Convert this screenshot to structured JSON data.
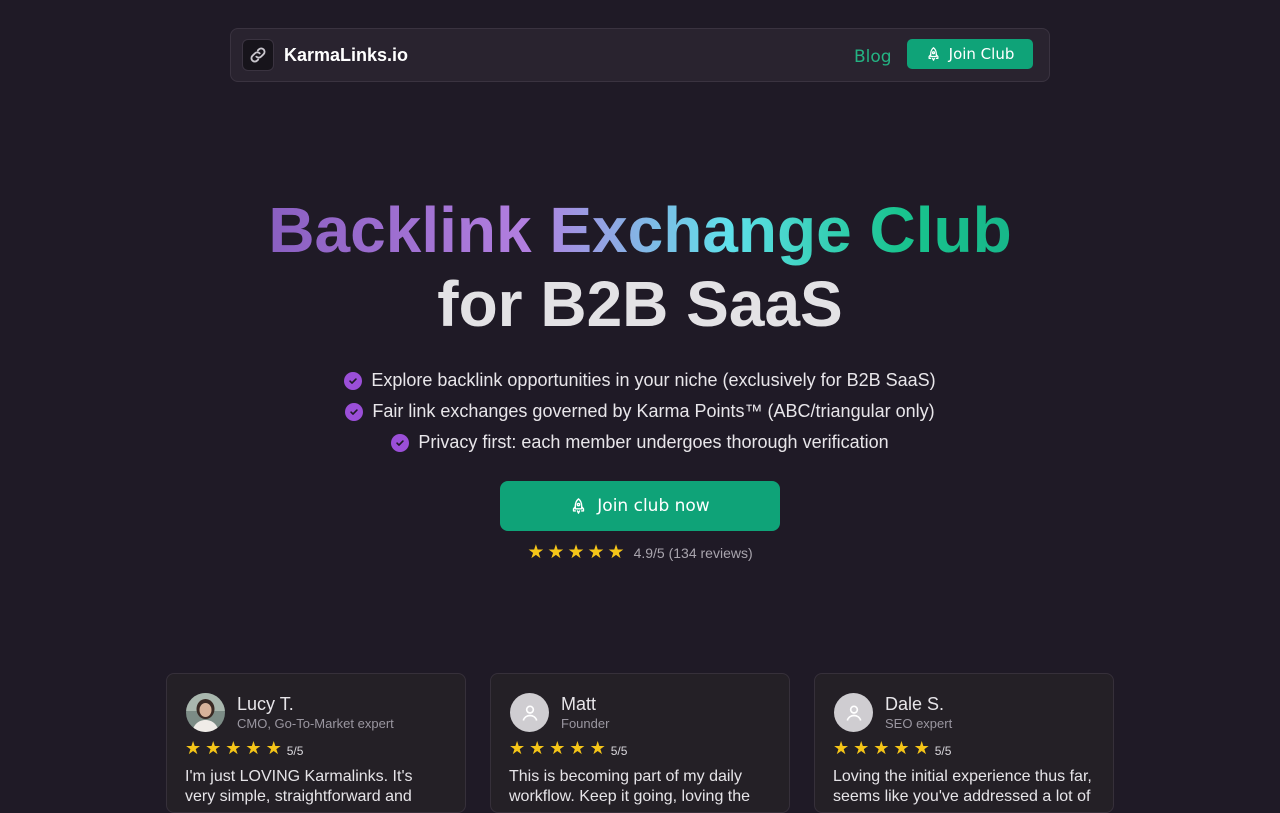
{
  "nav": {
    "brand": "KarmaLinks.io",
    "blog_label": "Blog",
    "join_label": "Join Club"
  },
  "hero": {
    "title_line1": "Backlink Exchange Club",
    "title_line2": "for B2B SaaS",
    "features": [
      "Explore backlink opportunities in your niche (exclusively for B2B SaaS)",
      "Fair link exchanges governed by Karma Points™ (ABC/triangular only)",
      "Privacy first: each member undergoes thorough verification"
    ],
    "cta_label": "Join club now",
    "rating_stars": 5,
    "rating_text": "4.9/5 (134 reviews)"
  },
  "reviews": [
    {
      "name": "Lucy T.",
      "role": "CMO, Go-To-Market expert",
      "score": "5/5",
      "quote": "I'm just LOVING Karmalinks. It's very simple, straightforward and"
    },
    {
      "name": "Matt",
      "role": "Founder",
      "score": "5/5",
      "quote": "This is becoming part of my daily workflow. Keep it going, loving the"
    },
    {
      "name": "Dale S.",
      "role": "SEO expert",
      "score": "5/5",
      "quote": "Loving the initial experience thus far, seems like you've addressed a lot of"
    }
  ],
  "colors": {
    "background": "#1f1a26",
    "accent_green": "#0fa378",
    "check_purple": "#9b4fd8",
    "star_yellow": "#f5c518"
  },
  "icons": {
    "logo": "link-icon",
    "cta": "rocket-icon",
    "feature": "check-circle-icon",
    "rating": "star-icon",
    "avatar_placeholder": "user-icon"
  }
}
